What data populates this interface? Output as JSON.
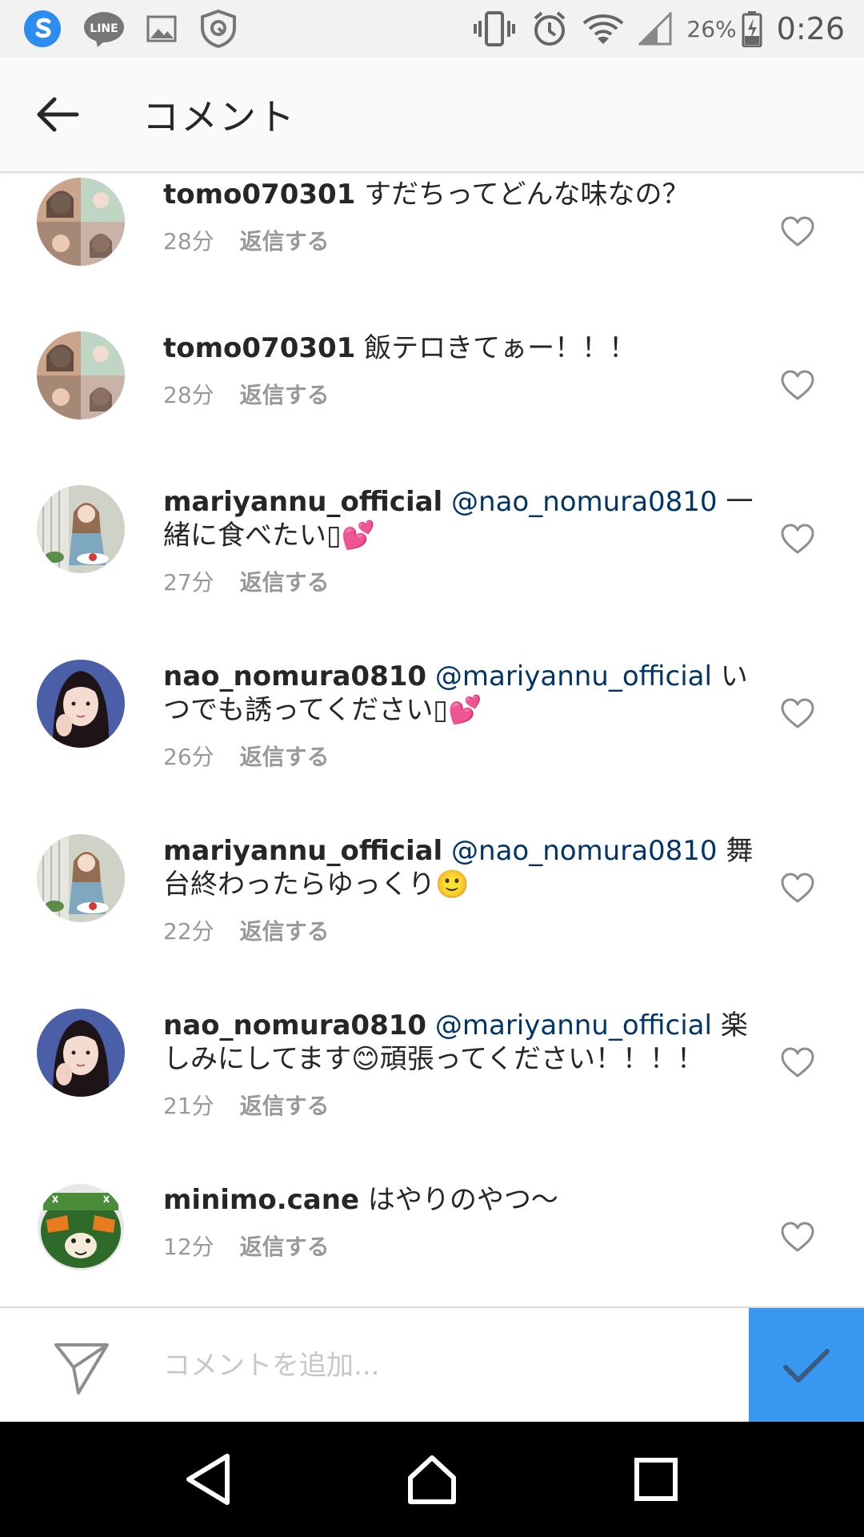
{
  "status_bar": {
    "battery": "26%",
    "time": "0:26",
    "line_label": "LINE"
  },
  "header": {
    "title": "コメント"
  },
  "comments": [
    {
      "username": "tomo070301",
      "mention": "",
      "text": "すだちってどんな味なの？",
      "time": "28分",
      "reply": "返信する"
    },
    {
      "username": "tomo070301",
      "mention": "",
      "text": "飯テロきてぁー！！！",
      "time": "28分",
      "reply": "返信する"
    },
    {
      "username": "mariyannu_official",
      "mention": "@nao_nomura0810",
      "text": "一緒に食べたい▯💕",
      "time": "27分",
      "reply": "返信する"
    },
    {
      "username": "nao_nomura0810",
      "mention": "@mariyannu_official",
      "text": "いつでも誘ってください▯💕",
      "time": "26分",
      "reply": "返信する"
    },
    {
      "username": "mariyannu_official",
      "mention": "@nao_nomura0810",
      "text": "舞台終わったらゆっくり🙂",
      "time": "22分",
      "reply": "返信する"
    },
    {
      "username": "nao_nomura0810",
      "mention": "@mariyannu_official",
      "text": "楽しみにしてます😊頑張ってください！！！！",
      "time": "21分",
      "reply": "返信する"
    },
    {
      "username": "minimo.cane",
      "mention": "",
      "text": "はやりのやつ〜",
      "time": "12分",
      "reply": "返信する"
    }
  ],
  "input": {
    "placeholder": "コメントを追加..."
  },
  "colors": {
    "accent": "#3897f0",
    "mention": "#003569",
    "meta": "#999999"
  }
}
